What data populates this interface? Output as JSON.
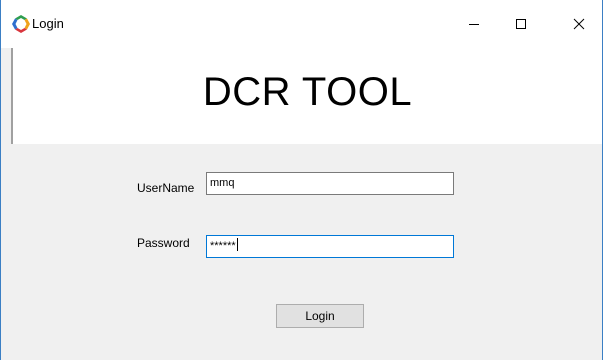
{
  "window": {
    "title": "Login",
    "app_icon": "app-logo-icon",
    "controls": [
      "minimize-icon",
      "maximize-icon",
      "close-icon"
    ]
  },
  "header": {
    "title": "DCR TOOL"
  },
  "form": {
    "username_label": "UserName",
    "username_value": "mmq",
    "password_label": "Password",
    "password_masked": "******",
    "login_button": "Login"
  },
  "colors": {
    "window_border": "#3b7fc4",
    "focus_border": "#0078d7",
    "form_background": "#f0f0f0"
  }
}
